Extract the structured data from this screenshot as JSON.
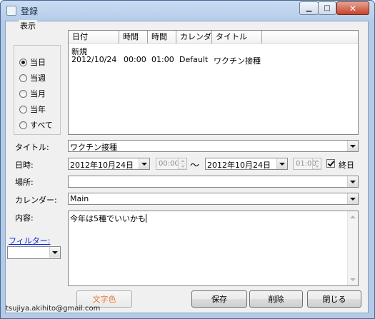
{
  "window": {
    "title": "登録"
  },
  "display_group": {
    "legend": "表示",
    "options": [
      "当日",
      "当週",
      "当月",
      "当年",
      "すべて"
    ],
    "selected": "当日"
  },
  "list": {
    "columns": [
      "日付",
      "時間",
      "時間",
      "カレンダ",
      "タイトル"
    ],
    "rows": [
      {
        "date": "新規",
        "start": "",
        "end": "",
        "calendar": "",
        "title": ""
      },
      {
        "date": "2012/10/24",
        "start": "00:00",
        "end": "01:00",
        "calendar": "Default",
        "title": "ワクチン接種"
      }
    ]
  },
  "form": {
    "title_label": "タイトル:",
    "title_value": "ワクチン接種",
    "datetime_label": "日時:",
    "start_date": "2012年10月24日",
    "start_time": "00:00",
    "range_sep": "～",
    "end_date": "2012年10月24日",
    "end_time": "01:00",
    "allday_label": "終日",
    "allday_checked": true,
    "place_label": "場所:",
    "place_value": "",
    "calendar_label": "カレンダー:",
    "calendar_value": "Main",
    "content_label": "内容:",
    "content_value": "今年は5種でいいかも"
  },
  "filter": {
    "label": "フィルター:",
    "value": ""
  },
  "buttons": {
    "text_color": "文字色",
    "save": "保存",
    "delete": "削除",
    "close": "閉じる"
  },
  "footer": {
    "email": "tsujiya.akihito@gmail.com"
  },
  "colors": {
    "link": "#0b24e5",
    "text_color_button": "#e67a2e"
  }
}
